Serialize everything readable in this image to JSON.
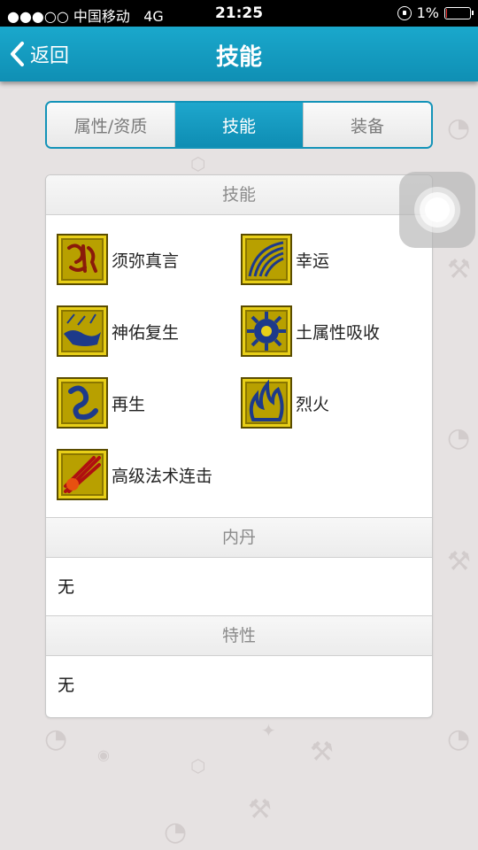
{
  "status_bar": {
    "signal": "●●●○○",
    "carrier": "中国移动",
    "network": "4G",
    "time": "21:25",
    "battery": "1%"
  },
  "nav": {
    "back_label": "返回",
    "title": "技能"
  },
  "tabs": [
    {
      "label": "属性/资质",
      "active": false
    },
    {
      "label": "技能",
      "active": true
    },
    {
      "label": "装备",
      "active": false
    }
  ],
  "sections": {
    "skills_title": "技能",
    "skills": [
      {
        "label": "须弥真言",
        "icon": "sanskrit-rune-icon"
      },
      {
        "label": "幸运",
        "icon": "rainbow-arc-icon"
      },
      {
        "label": "神佑复生",
        "icon": "rebirth-beast-icon"
      },
      {
        "label": "土属性吸收",
        "icon": "earth-gear-icon"
      },
      {
        "label": "再生",
        "icon": "regen-creature-icon"
      },
      {
        "label": "烈火",
        "icon": "flame-icon"
      },
      {
        "label": "高级法术连击",
        "icon": "spell-combo-icon"
      }
    ],
    "neidan_title": "内丹",
    "neidan_value": "无",
    "traits_title": "特性",
    "traits_value": "无"
  },
  "colors": {
    "accent": "#1393b8",
    "nav_bg": "#1aa8cc",
    "page_bg": "#e6e2e2"
  }
}
